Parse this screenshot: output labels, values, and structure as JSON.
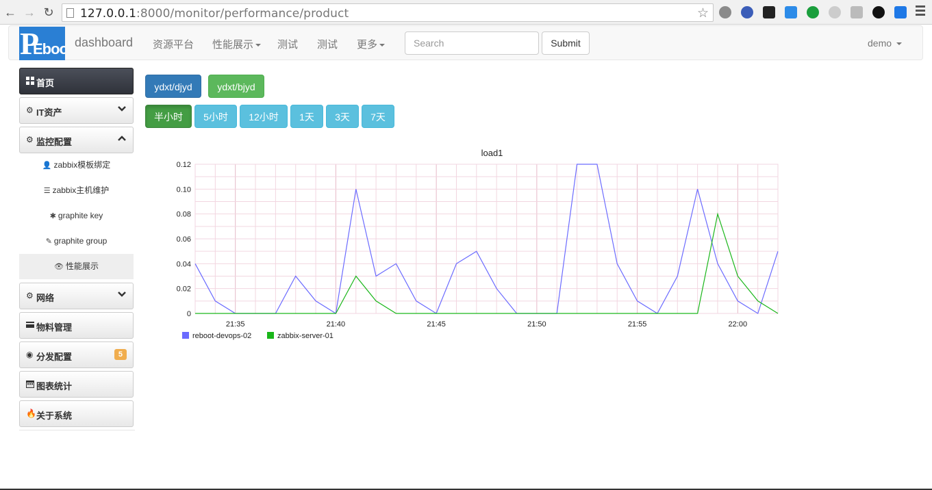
{
  "browser": {
    "url_host": "127.0.0.1",
    "url_path": ":8000/monitor/performance/product"
  },
  "navbar": {
    "brand": "dashboard",
    "items": [
      {
        "label": "资源平台",
        "dropdown": false
      },
      {
        "label": "性能展示",
        "dropdown": true
      },
      {
        "label": "测试",
        "dropdown": false
      },
      {
        "label": "测试",
        "dropdown": false
      },
      {
        "label": "更多",
        "dropdown": true
      }
    ],
    "search_placeholder": "Search",
    "submit_label": "Submit",
    "user": "demo"
  },
  "sidebar": {
    "items": [
      {
        "label": "首页",
        "icon": "th-large-icon",
        "active": true
      },
      {
        "label": "IT资产",
        "icon": "cog-icon",
        "chevron": "down"
      },
      {
        "label": "监控配置",
        "icon": "cog-icon",
        "chevron": "up"
      },
      {
        "label": "网络",
        "icon": "cog-icon",
        "chevron": "down"
      },
      {
        "label": "物料管理",
        "icon": "credit-card-icon"
      },
      {
        "label": "分发配置",
        "icon": "globe-icon",
        "badge": "5"
      },
      {
        "label": "图表统计",
        "icon": "calendar-icon"
      },
      {
        "label": "关于系统",
        "icon": "fire-icon"
      }
    ],
    "subitems": [
      {
        "label": "zabbix模板绑定",
        "icon": "user-icon"
      },
      {
        "label": "zabbix主机维护",
        "icon": "list-icon"
      },
      {
        "label": "graphite key",
        "icon": "asterisk-icon"
      },
      {
        "label": "graphite group",
        "icon": "edit-icon"
      },
      {
        "label": "性能展示",
        "icon": "eye-icon",
        "active": true
      }
    ]
  },
  "groups": [
    {
      "label": "ydxt/djyd",
      "style": "primary"
    },
    {
      "label": "ydxt/bjyd",
      "style": "success"
    }
  ],
  "ranges": [
    {
      "label": "半小时",
      "active": true
    },
    {
      "label": "5小时"
    },
    {
      "label": "12小时"
    },
    {
      "label": "1天"
    },
    {
      "label": "3天"
    },
    {
      "label": "7天"
    }
  ],
  "colors": {
    "series1": "#6b6bff",
    "series2": "#1ab61a",
    "grid": "#f2d6e0"
  },
  "chart_data": {
    "type": "line",
    "title": "load1",
    "xlabel": "",
    "ylabel": "",
    "x_ticks": [
      "21:35",
      "21:40",
      "21:45",
      "21:50",
      "21:55",
      "22:00"
    ],
    "y_ticks": [
      "0.12",
      "0.10",
      "0.08",
      "0.06",
      "0.04",
      "0.02",
      "0"
    ],
    "ylim": [
      0,
      0.12
    ],
    "x_unit": "minute",
    "x_start": "21:33",
    "x": [
      "21:33",
      "21:34",
      "21:35",
      "21:36",
      "21:37",
      "21:38",
      "21:39",
      "21:40",
      "21:41",
      "21:42",
      "21:43",
      "21:44",
      "21:45",
      "21:46",
      "21:47",
      "21:48",
      "21:49",
      "21:50",
      "21:51",
      "21:52",
      "21:53",
      "21:54",
      "21:55",
      "21:56",
      "21:57",
      "21:58",
      "21:59",
      "22:00",
      "22:01",
      "22:02"
    ],
    "grid": true,
    "legend_position": "bottom-left",
    "series": [
      {
        "name": "reboot-devops-02",
        "values": [
          0.04,
          0.01,
          0,
          0,
          0,
          0.03,
          0.01,
          0,
          0.1,
          0.03,
          0.04,
          0.01,
          0,
          0.04,
          0.05,
          0.02,
          0,
          0,
          0,
          0.12,
          0.12,
          0.04,
          0.01,
          0,
          0.03,
          0.1,
          0.04,
          0.01,
          0,
          0.05
        ]
      },
      {
        "name": "zabbix-server-01",
        "values": [
          0,
          0,
          0,
          0,
          0,
          0,
          0,
          0,
          0.03,
          0.01,
          0,
          0,
          0,
          0,
          0,
          0,
          0,
          0,
          0,
          0,
          0,
          0,
          0,
          0,
          0,
          0,
          0.08,
          0.03,
          0.01,
          0
        ]
      }
    ]
  }
}
